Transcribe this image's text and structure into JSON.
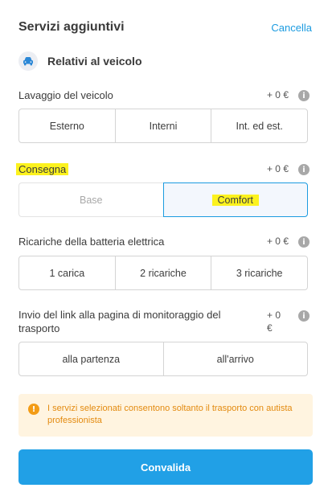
{
  "header": {
    "title": "Servizi aggiuntivi",
    "cancel_label": "Cancella"
  },
  "section": {
    "title": "Relativi al veicolo",
    "icon": "car-icon"
  },
  "groups": [
    {
      "label": "Lavaggio del veicolo",
      "price": "+ 0 €",
      "options": [
        "Esterno",
        "Interni",
        "Int. ed est."
      ]
    },
    {
      "label": "Consegna",
      "price": "+  0 €",
      "options": [
        "Base",
        "Comfort"
      ],
      "selected": "Comfort"
    },
    {
      "label": "Ricariche della batteria elettrica",
      "price": "+ 0 €",
      "options": [
        "1 carica",
        "2 ricariche",
        "3 ricariche"
      ]
    },
    {
      "label_line1": "Invio del link alla pagina di monitoraggio del",
      "label_line2": "trasporto",
      "price_line1": "+ 0",
      "price_line2": "€",
      "options": [
        "alla partenza",
        "all'arrivo"
      ]
    }
  ],
  "info_glyph": "i",
  "notice": {
    "text": "I servizi selezionati consentono soltanto il trasporto con autista professionista",
    "icon": "warning-icon"
  },
  "submit_label": "Convalida",
  "colors": {
    "accent": "#21a0e6",
    "link": "#1b9be0",
    "highlight": "#fcf21e",
    "warning": "#f39c16"
  }
}
